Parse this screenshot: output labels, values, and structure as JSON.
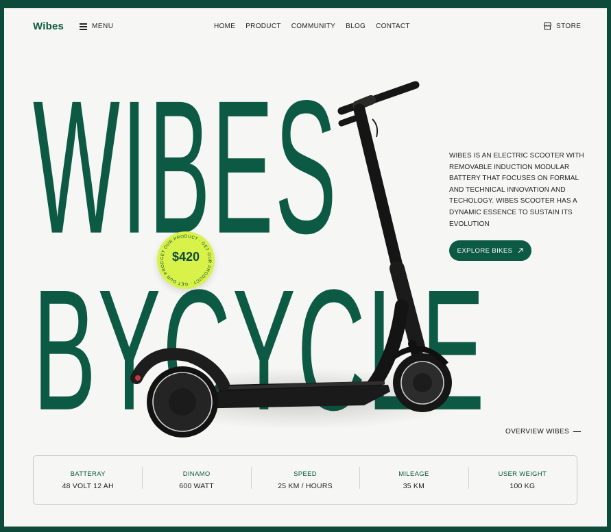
{
  "brand": {
    "name": "Wibes"
  },
  "nav": {
    "menu_label": "MENU",
    "links": [
      "HOME",
      "PRODUCT",
      "COMMUNITY",
      "BLOG",
      "CONTACT"
    ],
    "store_label": "STORE"
  },
  "hero": {
    "headline_line1": "WIBES",
    "headline_line2": "BYCYCLE",
    "description": "WIBES IS AN ELECTRIC SCOOTER WITH REMOVABLE INDUCTION MODULAR BATTERY THAT FOCUSES ON FORMAL AND TECHNICAL INNOVATION AND TECHOLOGY. WIBES SCOOTER HAS A DYNAMIC ESSENCE TO SUSTAIN ITS EVOLUTION",
    "cta_label": "EXPLORE BIKES",
    "overview_label": "OVERVIEW WIBES"
  },
  "badge": {
    "price": "$420",
    "ring_text": "GET OUR PRODUCT · GET OUR PRODUCT · GET OUR PRODUCT ·"
  },
  "specs": [
    {
      "label": "BATTERAY",
      "value": "48 VOLT 12 AH"
    },
    {
      "label": "DINAMO",
      "value": "600 WATT"
    },
    {
      "label": "SPEED",
      "value": "25 KM / HOURS"
    },
    {
      "label": "MILEAGE",
      "value": "35 KM"
    },
    {
      "label": "USER WEIGHT",
      "value": "100 KG"
    }
  ],
  "colors": {
    "brand_green": "#0d5a44",
    "badge_lime": "#d8f24a",
    "frame_bg": "#0d4a3a"
  },
  "icons": [
    "hamburger-icon",
    "store-icon",
    "arrow-up-right-icon",
    "scooter-image"
  ]
}
